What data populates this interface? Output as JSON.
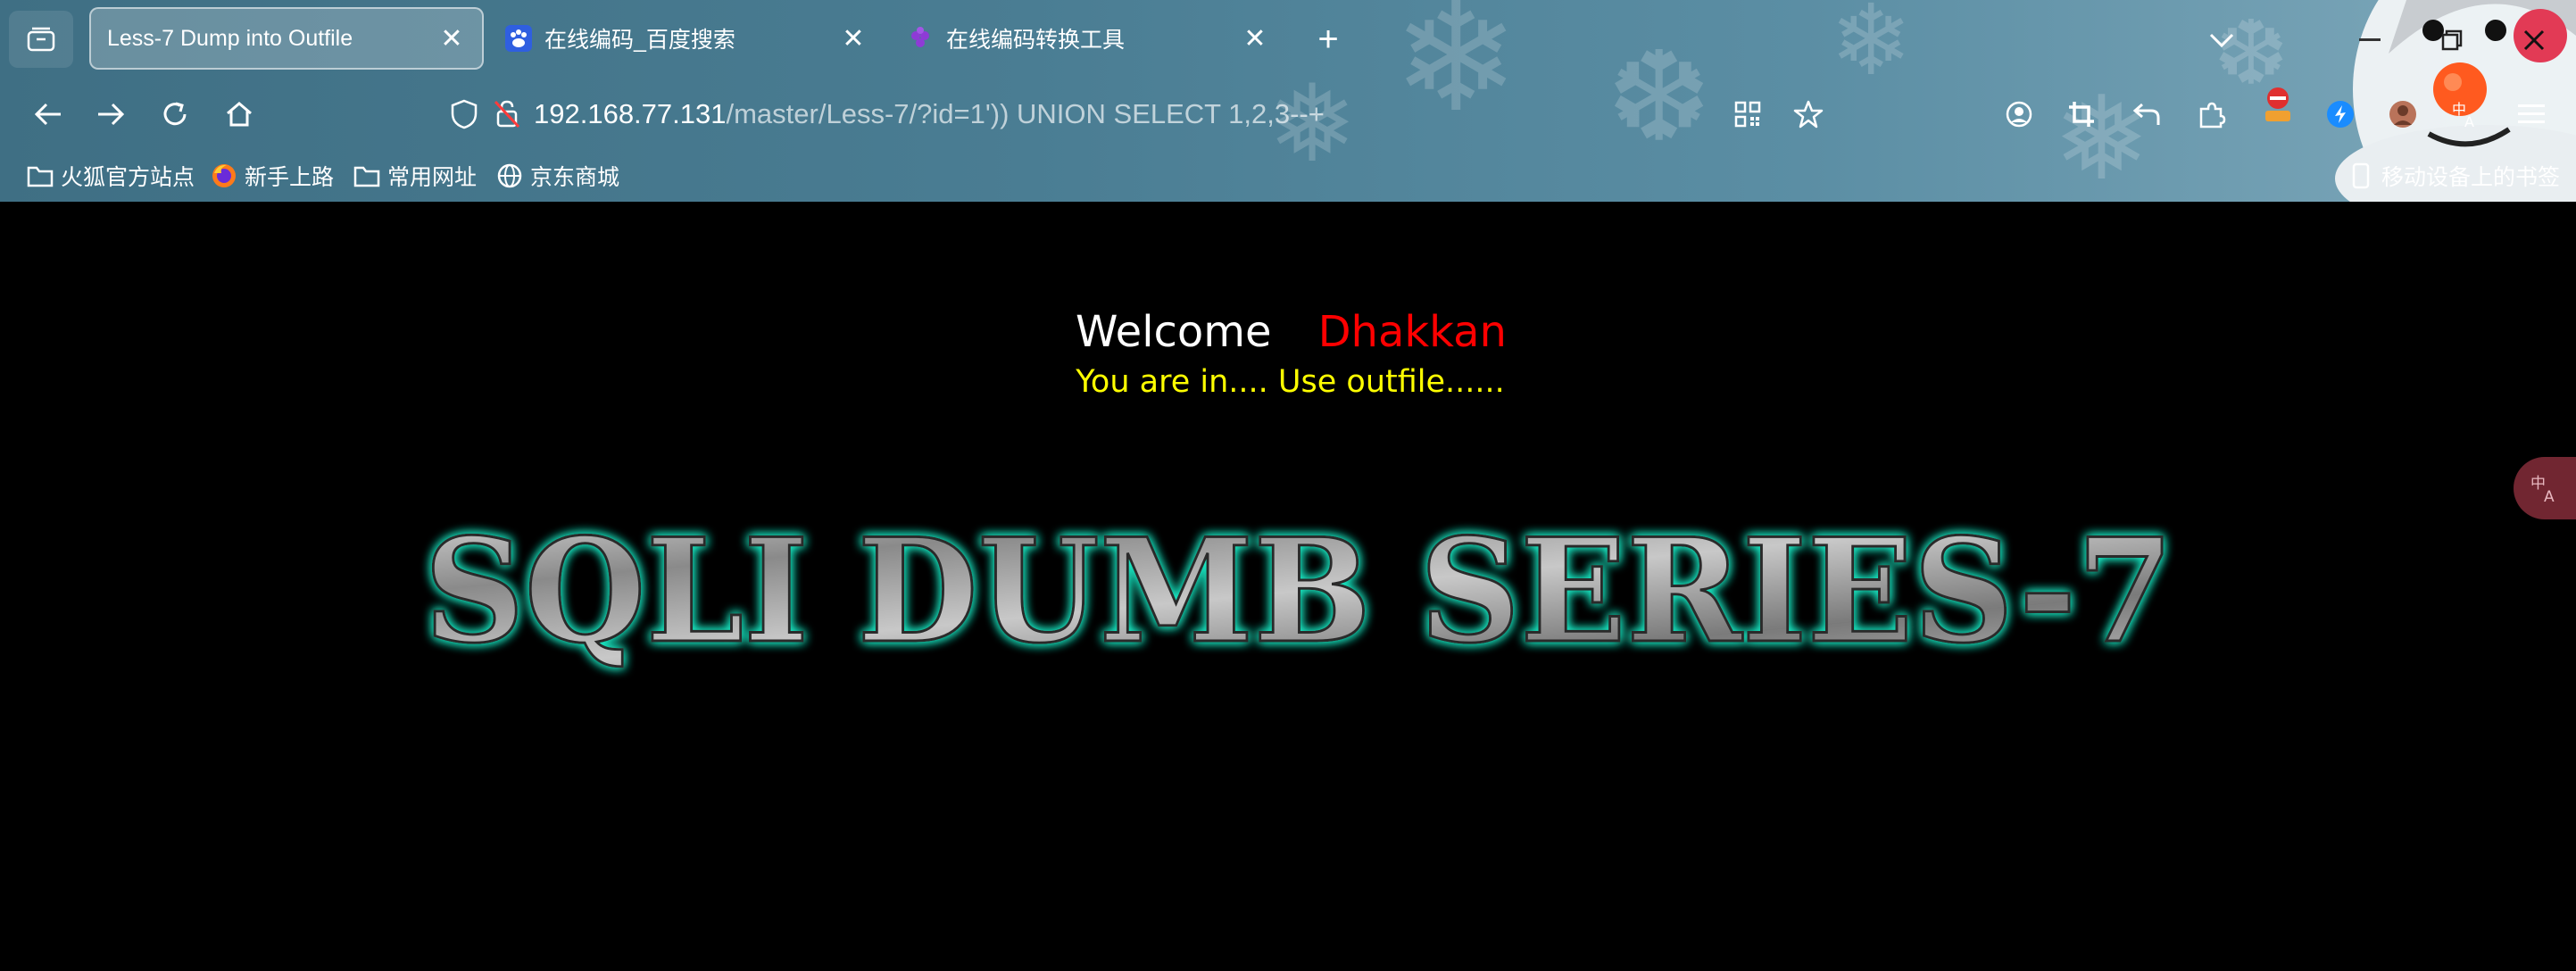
{
  "tabs": [
    {
      "title": "Less-7 Dump into Outfile",
      "active": true
    },
    {
      "title": "在线编码_百度搜索",
      "active": false
    },
    {
      "title": "在线编码转换工具",
      "active": false
    }
  ],
  "url": {
    "host": "192.168.77.131",
    "path": "/master/Less-7/?id=1')) UNION SELECT 1,2,3--+"
  },
  "bookmarks": [
    {
      "label": "火狐官方站点",
      "icon": "folder-icon"
    },
    {
      "label": "新手上路",
      "icon": "firefox-icon"
    },
    {
      "label": "常用网址",
      "icon": "folder-icon"
    },
    {
      "label": "京东商城",
      "icon": "globe-icon"
    }
  ],
  "mobile_bookmarks": "移动设备上的书签",
  "page": {
    "welcome": "Welcome",
    "name": "Dhakkan",
    "status": "You are in.... Use outfile......",
    "banner": "SQLI DUMB SERIES-7"
  },
  "colors": {
    "welcome": "#ffffff",
    "name": "#ff0000",
    "status": "#ffff00",
    "banner_glow": "#1de9c4"
  }
}
